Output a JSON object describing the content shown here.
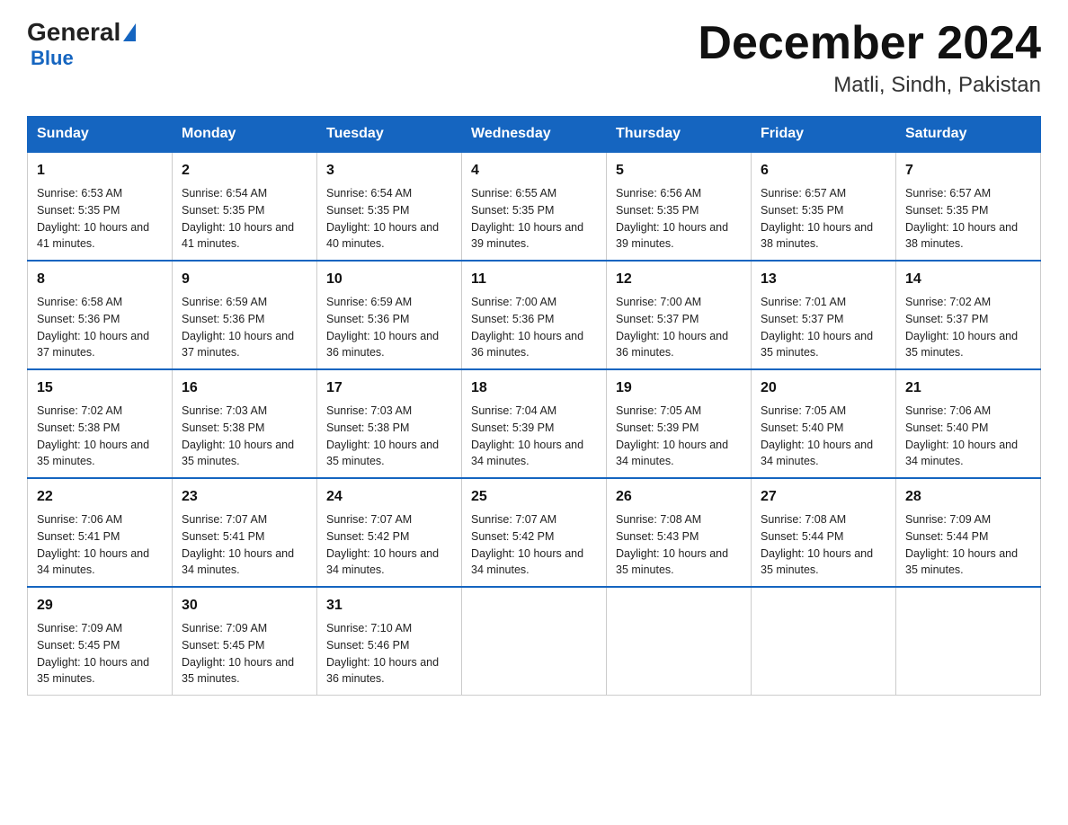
{
  "logo": {
    "general": "General",
    "blue": "Blue"
  },
  "title": "December 2024",
  "subtitle": "Matli, Sindh, Pakistan",
  "days_of_week": [
    "Sunday",
    "Monday",
    "Tuesday",
    "Wednesday",
    "Thursday",
    "Friday",
    "Saturday"
  ],
  "weeks": [
    [
      {
        "day": 1,
        "sunrise": "6:53 AM",
        "sunset": "5:35 PM",
        "daylight": "10 hours and 41 minutes."
      },
      {
        "day": 2,
        "sunrise": "6:54 AM",
        "sunset": "5:35 PM",
        "daylight": "10 hours and 41 minutes."
      },
      {
        "day": 3,
        "sunrise": "6:54 AM",
        "sunset": "5:35 PM",
        "daylight": "10 hours and 40 minutes."
      },
      {
        "day": 4,
        "sunrise": "6:55 AM",
        "sunset": "5:35 PM",
        "daylight": "10 hours and 39 minutes."
      },
      {
        "day": 5,
        "sunrise": "6:56 AM",
        "sunset": "5:35 PM",
        "daylight": "10 hours and 39 minutes."
      },
      {
        "day": 6,
        "sunrise": "6:57 AM",
        "sunset": "5:35 PM",
        "daylight": "10 hours and 38 minutes."
      },
      {
        "day": 7,
        "sunrise": "6:57 AM",
        "sunset": "5:35 PM",
        "daylight": "10 hours and 38 minutes."
      }
    ],
    [
      {
        "day": 8,
        "sunrise": "6:58 AM",
        "sunset": "5:36 PM",
        "daylight": "10 hours and 37 minutes."
      },
      {
        "day": 9,
        "sunrise": "6:59 AM",
        "sunset": "5:36 PM",
        "daylight": "10 hours and 37 minutes."
      },
      {
        "day": 10,
        "sunrise": "6:59 AM",
        "sunset": "5:36 PM",
        "daylight": "10 hours and 36 minutes."
      },
      {
        "day": 11,
        "sunrise": "7:00 AM",
        "sunset": "5:36 PM",
        "daylight": "10 hours and 36 minutes."
      },
      {
        "day": 12,
        "sunrise": "7:00 AM",
        "sunset": "5:37 PM",
        "daylight": "10 hours and 36 minutes."
      },
      {
        "day": 13,
        "sunrise": "7:01 AM",
        "sunset": "5:37 PM",
        "daylight": "10 hours and 35 minutes."
      },
      {
        "day": 14,
        "sunrise": "7:02 AM",
        "sunset": "5:37 PM",
        "daylight": "10 hours and 35 minutes."
      }
    ],
    [
      {
        "day": 15,
        "sunrise": "7:02 AM",
        "sunset": "5:38 PM",
        "daylight": "10 hours and 35 minutes."
      },
      {
        "day": 16,
        "sunrise": "7:03 AM",
        "sunset": "5:38 PM",
        "daylight": "10 hours and 35 minutes."
      },
      {
        "day": 17,
        "sunrise": "7:03 AM",
        "sunset": "5:38 PM",
        "daylight": "10 hours and 35 minutes."
      },
      {
        "day": 18,
        "sunrise": "7:04 AM",
        "sunset": "5:39 PM",
        "daylight": "10 hours and 34 minutes."
      },
      {
        "day": 19,
        "sunrise": "7:05 AM",
        "sunset": "5:39 PM",
        "daylight": "10 hours and 34 minutes."
      },
      {
        "day": 20,
        "sunrise": "7:05 AM",
        "sunset": "5:40 PM",
        "daylight": "10 hours and 34 minutes."
      },
      {
        "day": 21,
        "sunrise": "7:06 AM",
        "sunset": "5:40 PM",
        "daylight": "10 hours and 34 minutes."
      }
    ],
    [
      {
        "day": 22,
        "sunrise": "7:06 AM",
        "sunset": "5:41 PM",
        "daylight": "10 hours and 34 minutes."
      },
      {
        "day": 23,
        "sunrise": "7:07 AM",
        "sunset": "5:41 PM",
        "daylight": "10 hours and 34 minutes."
      },
      {
        "day": 24,
        "sunrise": "7:07 AM",
        "sunset": "5:42 PM",
        "daylight": "10 hours and 34 minutes."
      },
      {
        "day": 25,
        "sunrise": "7:07 AM",
        "sunset": "5:42 PM",
        "daylight": "10 hours and 34 minutes."
      },
      {
        "day": 26,
        "sunrise": "7:08 AM",
        "sunset": "5:43 PM",
        "daylight": "10 hours and 35 minutes."
      },
      {
        "day": 27,
        "sunrise": "7:08 AM",
        "sunset": "5:44 PM",
        "daylight": "10 hours and 35 minutes."
      },
      {
        "day": 28,
        "sunrise": "7:09 AM",
        "sunset": "5:44 PM",
        "daylight": "10 hours and 35 minutes."
      }
    ],
    [
      {
        "day": 29,
        "sunrise": "7:09 AM",
        "sunset": "5:45 PM",
        "daylight": "10 hours and 35 minutes."
      },
      {
        "day": 30,
        "sunrise": "7:09 AM",
        "sunset": "5:45 PM",
        "daylight": "10 hours and 35 minutes."
      },
      {
        "day": 31,
        "sunrise": "7:10 AM",
        "sunset": "5:46 PM",
        "daylight": "10 hours and 36 minutes."
      },
      null,
      null,
      null,
      null
    ]
  ]
}
